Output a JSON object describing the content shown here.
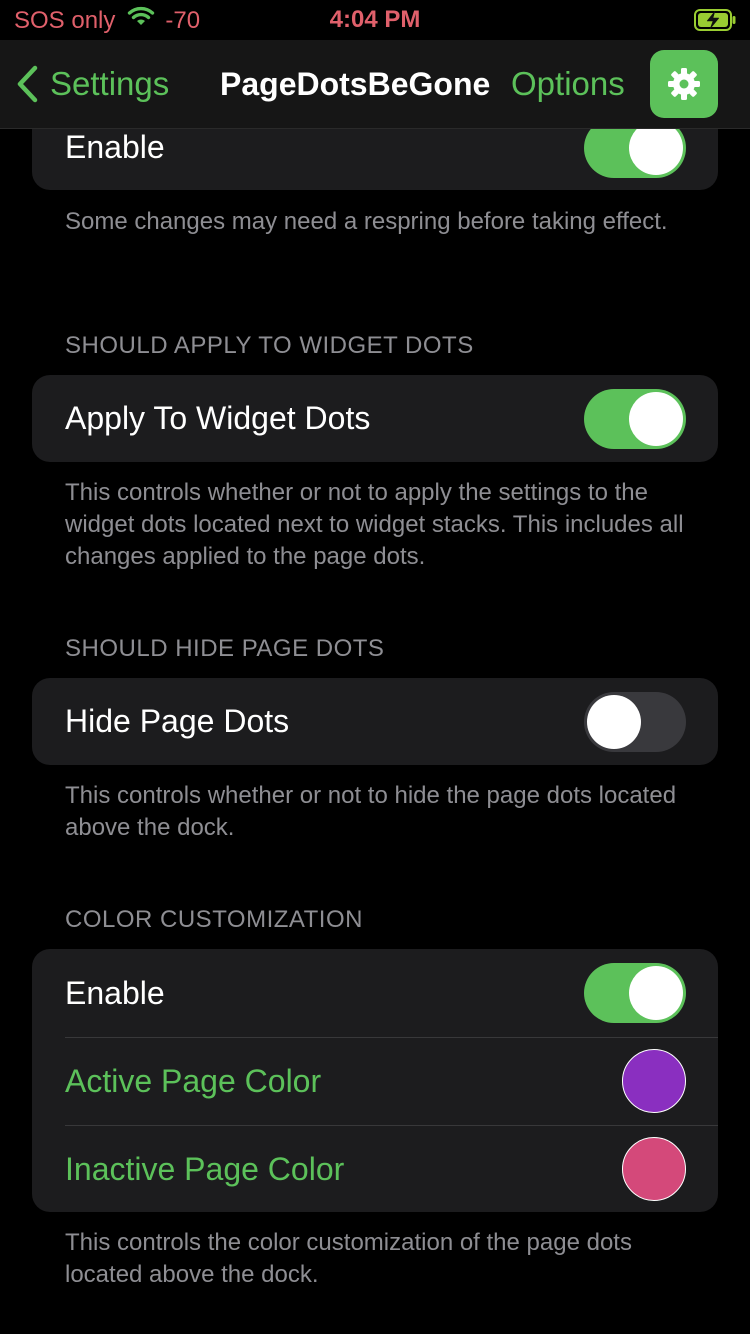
{
  "status_bar": {
    "carrier": "SOS only",
    "signal": "-70",
    "time": "4:04 PM",
    "wifi_icon": "wifi-icon",
    "battery_icon": "battery-charging-icon"
  },
  "nav": {
    "back_label": "Settings",
    "title": "PageDotsBeGone",
    "options_label": "Options",
    "gear_icon": "gear-icon"
  },
  "colors": {
    "accent": "#5cc15a",
    "active_page_color": "#8a2fc0",
    "inactive_page_color": "#d4497a"
  },
  "sections": [
    {
      "rows": [
        {
          "label": "Enable",
          "type": "toggle",
          "value": true
        }
      ],
      "footer": "Some changes may need a respring before taking effect."
    },
    {
      "header": "SHOULD APPLY TO WIDGET DOTS",
      "rows": [
        {
          "label": "Apply To Widget Dots",
          "type": "toggle",
          "value": true
        }
      ],
      "footer": "This controls whether or not to apply the settings to the widget dots located next to widget stacks. This includes all changes applied to the page dots."
    },
    {
      "header": "SHOULD HIDE PAGE DOTS",
      "rows": [
        {
          "label": "Hide Page Dots",
          "type": "toggle",
          "value": false
        }
      ],
      "footer": "This controls whether or not to hide the page dots located above the dock."
    },
    {
      "header": "COLOR CUSTOMIZATION",
      "rows": [
        {
          "label": "Enable",
          "type": "toggle",
          "value": true
        },
        {
          "label": "Active Page Color",
          "type": "color",
          "value": "#8a2fc0"
        },
        {
          "label": "Inactive Page Color",
          "type": "color",
          "value": "#d4497a"
        }
      ],
      "footer": "This controls the color customization of the page dots located above the dock."
    }
  ]
}
